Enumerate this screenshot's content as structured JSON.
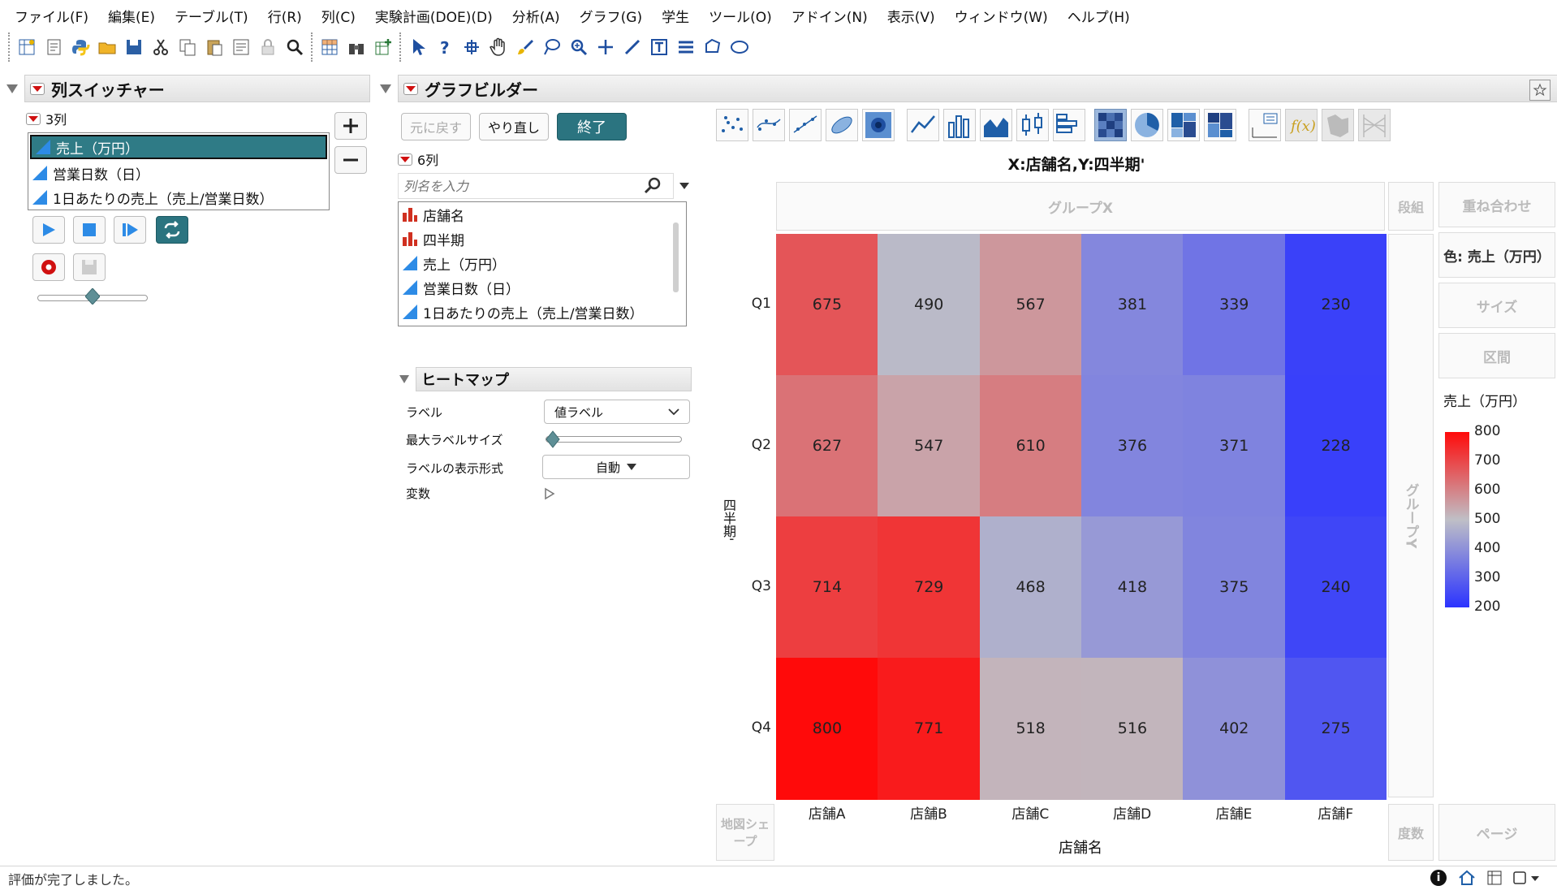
{
  "menu": [
    "ファイル(F)",
    "編集(E)",
    "テーブル(T)",
    "行(R)",
    "列(C)",
    "実験計画(DOE)(D)",
    "分析(A)",
    "グラフ(G)",
    "学生",
    "ツール(O)",
    "アドイン(N)",
    "表示(V)",
    "ウィンドウ(W)",
    "ヘルプ(H)"
  ],
  "toolbar_icons": [
    "new-data-table",
    "new-script",
    "python",
    "open",
    "save",
    "cut",
    "copy",
    "paste",
    "properties",
    "lock",
    "search",
    "data-table",
    "binoculars",
    "add-table",
    "arrow",
    "help",
    "crosshair",
    "hand",
    "brush",
    "lasso",
    "zoom",
    "plus",
    "line",
    "text",
    "list",
    "polygon",
    "ellipse"
  ],
  "column_switcher": {
    "title": "列スイッチャー",
    "count": "3列",
    "columns": [
      "売上（万円）",
      "営業日数（日）",
      "1日あたりの売上（売上/営業日数）"
    ],
    "selected_index": 0,
    "slider_value": 0.5
  },
  "graph_builder": {
    "title": "グラフビルダー",
    "undo_label": "元に戻す",
    "redo_label": "やり直し",
    "done_label": "終了",
    "field_count": "6列",
    "search_placeholder": "列名を入力",
    "fields": [
      {
        "name": "店舗名",
        "type": "nominal"
      },
      {
        "name": "四半期",
        "type": "nominal"
      },
      {
        "name": "売上（万円）",
        "type": "continuous"
      },
      {
        "name": "営業日数（日）",
        "type": "continuous"
      },
      {
        "name": "1日あたりの売上（売上/営業日数）",
        "type": "continuous"
      }
    ]
  },
  "heatmap_props": {
    "title": "ヒートマップ",
    "label_label": "ラベル",
    "label_value": "値ラベル",
    "max_label_size_label": "最大ラベルサイズ",
    "max_label_size_value": 0,
    "label_format_label": "ラベルの表示形式",
    "label_format_value": "自動",
    "variables_label": "変数"
  },
  "zones": {
    "group_x": "グループX",
    "wrap": "段組",
    "overlay": "重ね合わせ",
    "color": "色: 売上（万円）",
    "size": "サイズ",
    "interval": "区間",
    "group_y": "グループY",
    "map_shape": "地図シェープ",
    "freq": "度数",
    "page": "ページ"
  },
  "chart_data": {
    "type": "heatmap",
    "title": "X:店舗名,Y:四半期'",
    "xlabel": "店舗名",
    "ylabel": "四半期'",
    "x": [
      "店舗A",
      "店舗B",
      "店舗C",
      "店舗D",
      "店舗E",
      "店舗F"
    ],
    "y": [
      "Q1",
      "Q2",
      "Q3",
      "Q4"
    ],
    "values": [
      [
        675,
        490,
        567,
        381,
        339,
        230
      ],
      [
        627,
        547,
        610,
        376,
        371,
        228
      ],
      [
        714,
        729,
        468,
        418,
        375,
        240
      ],
      [
        800,
        771,
        518,
        516,
        402,
        275
      ]
    ],
    "color_scale": {
      "title": "売上（万円）",
      "min": 200,
      "max": 800,
      "ticks": [
        800,
        700,
        600,
        500,
        400,
        300,
        200
      ],
      "colors": [
        "#2b33ff",
        "#bfbfc6",
        "#ff0a0a"
      ]
    }
  },
  "status": {
    "text": "評価が完了しました。"
  }
}
